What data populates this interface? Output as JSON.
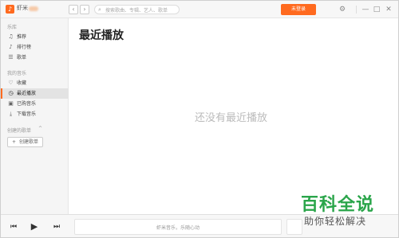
{
  "app": {
    "name": "虾米"
  },
  "topbar": {
    "back_icon": "chevron-left",
    "forward_icon": "chevron-right",
    "search_placeholder": "搜索歌曲、专辑、艺人、歌单",
    "login_label": "未登录"
  },
  "sidebar": {
    "library_title": "乐库",
    "library_items": [
      {
        "icon": "recommend-icon",
        "label": "推荐"
      },
      {
        "icon": "chart-icon",
        "label": "排行榜"
      },
      {
        "icon": "playlist-icon",
        "label": "歌单"
      }
    ],
    "my_title": "我的音乐",
    "my_items": [
      {
        "icon": "heart-icon",
        "label": "收藏"
      },
      {
        "icon": "clock-icon",
        "label": "最近播放",
        "active": true
      },
      {
        "icon": "purchased-icon",
        "label": "已购音乐"
      },
      {
        "icon": "download-icon",
        "label": "下载音乐"
      }
    ],
    "created_title": "创建的歌单",
    "create_label": "创建歌单"
  },
  "main": {
    "title": "最近播放",
    "empty_text": "还没有最近播放"
  },
  "player": {
    "song_text": "虾米音乐，乐随心动"
  },
  "watermark": {
    "title": "百科全说",
    "subtitle": "助你轻松解决"
  },
  "colors": {
    "accent": "#ff6a1f",
    "watermark_green": "#2aa54a"
  }
}
